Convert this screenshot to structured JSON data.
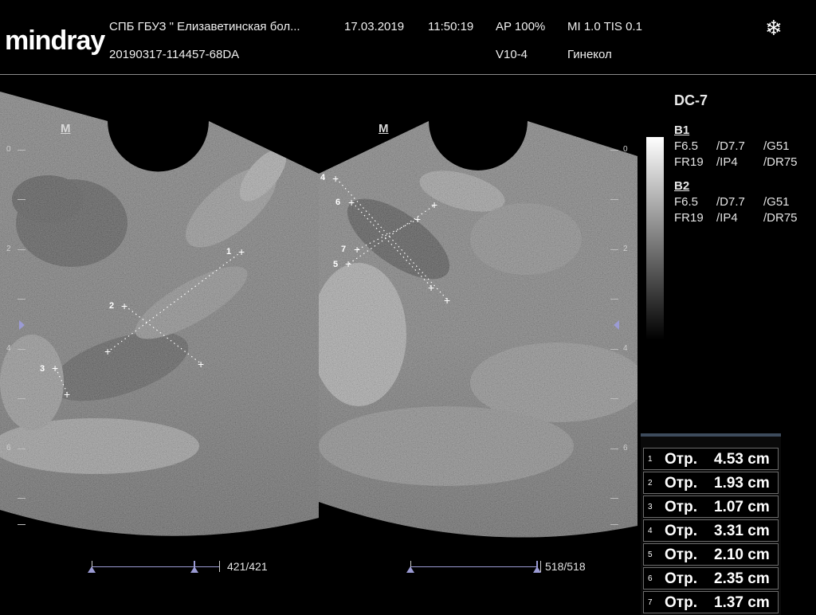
{
  "header": {
    "logo": "mindray",
    "institution": "СПБ  ГБУЗ \" Елизаветинская бол...",
    "date": "17.03.2019",
    "time": "11:50:19",
    "ap": "AP  100%",
    "mi_tis": "MI 1.0 TIS 0.1",
    "exam_id": "20190317-114457-68DA",
    "probe": "V10-4",
    "exam_type": "Гинекол",
    "freeze_icon": "snowflake-icon"
  },
  "images": {
    "left": {
      "orientation_mark": "M",
      "depth_labels": [
        "0",
        "2",
        "4",
        "6"
      ],
      "cine": "421/421"
    },
    "right": {
      "orientation_mark": "M",
      "depth_labels": [
        "0",
        "2",
        "4",
        "6"
      ],
      "cine": "518/518"
    }
  },
  "side_panel": {
    "preset": "DC-7",
    "b1": {
      "title": "B1",
      "row1": [
        "F6.5",
        "/D7.7",
        "/G51"
      ],
      "row2": [
        "FR19",
        "/IP4",
        "/DR75"
      ]
    },
    "b2": {
      "title": "B2",
      "row1": [
        "F6.5",
        "/D7.7",
        "/G51"
      ],
      "row2": [
        "FR19",
        "/IP4",
        "/DR75"
      ]
    }
  },
  "calipers": [
    "1",
    "2",
    "3",
    "4",
    "5",
    "6",
    "7"
  ],
  "measurements": [
    {
      "index": "1",
      "label": "Отр.",
      "value": "4.53 cm"
    },
    {
      "index": "2",
      "label": "Отр.",
      "value": "1.93 cm"
    },
    {
      "index": "3",
      "label": "Отр.",
      "value": "1.07 cm"
    },
    {
      "index": "4",
      "label": "Отр.",
      "value": "3.31 cm"
    },
    {
      "index": "5",
      "label": "Отр.",
      "value": "2.10 cm"
    },
    {
      "index": "6",
      "label": "Отр.",
      "value": "2.35 cm"
    },
    {
      "index": "7",
      "label": "Отр.",
      "value": "1.37 cm"
    }
  ]
}
